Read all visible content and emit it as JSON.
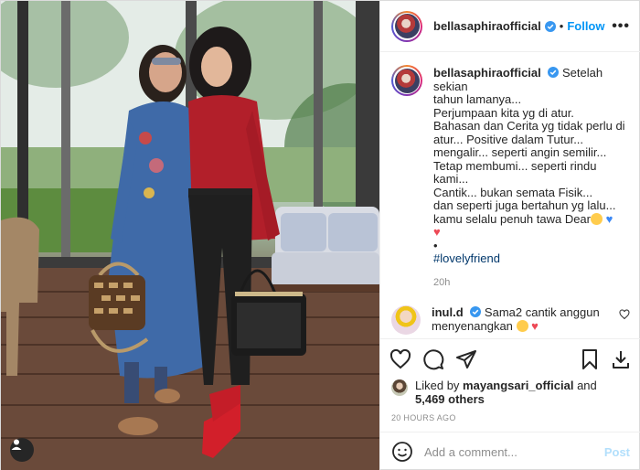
{
  "post": {
    "author": "bellasaphiraofficial",
    "verified": true,
    "follow_label": "Follow",
    "separator": "•",
    "more_label": "•••"
  },
  "caption": {
    "author": "bellasaphiraofficial",
    "lines": [
      "Setelah sekian",
      "tahun lamanya...",
      "Perjumpaan kita yg di atur.",
      "Bahasan dan Cerita yg tidak perlu di",
      "atur... Positive dalam Tutur...",
      "mengalir... seperti angin semilir...",
      "Tetap membumi... seperti rindu kami...",
      "Cantik... bukan semata Fisik...",
      "dan seperti juga bertahun yg lalu...",
      "kamu selalu penuh tawa Dear"
    ],
    "bullet": "•",
    "hashtag": "#lovelyfriend",
    "time": "20h"
  },
  "comments": [
    {
      "author": "inul.d",
      "verified": true,
      "text_line1": "Sama2 cantik anggun",
      "text_line2": "menyenangkan"
    }
  ],
  "actions": {
    "icons": [
      "heart-icon",
      "comment-icon",
      "share-icon",
      "bookmark-icon",
      "download-icon"
    ]
  },
  "likes": {
    "prefix": "Liked by",
    "user": "mayangsari_official",
    "conjunction": "and",
    "others": "5,469 others"
  },
  "posted_ago": "20 HOURS AGO",
  "add_comment": {
    "placeholder": "Add a comment...",
    "post_label": "Post"
  },
  "colors": {
    "accent": "#0095f6",
    "hashtag": "#00376b",
    "heart": "#ed4956",
    "muted": "#8e8e8e",
    "post_disabled": "#b2dffc"
  }
}
